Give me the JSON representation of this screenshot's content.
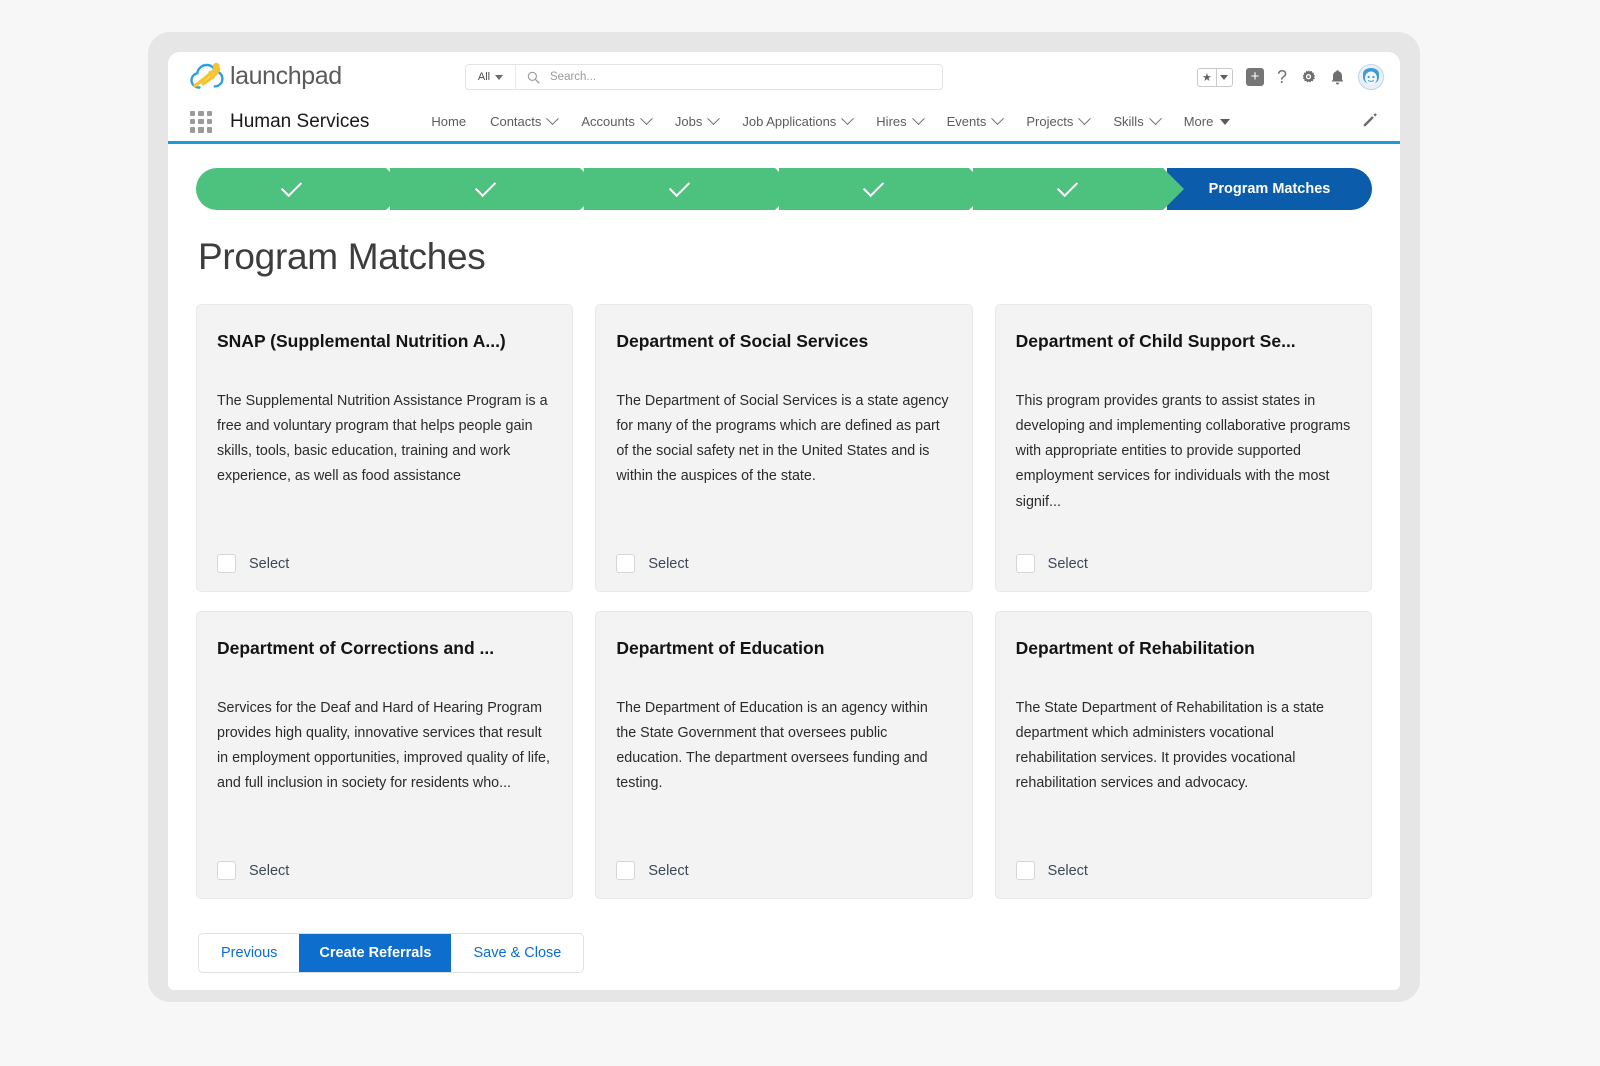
{
  "brand": {
    "logo_text": "launchpad",
    "logo_icon": "cloud-launch-icon"
  },
  "search": {
    "scope_label": "All",
    "placeholder": "Search...",
    "icon": "search-icon"
  },
  "header_actions": {
    "favorites_icon": "star-icon",
    "favorites_caret_icon": "caret-down-icon",
    "add_icon": "plus-square-icon",
    "help_icon": "question-mark-icon",
    "setup_icon": "gear-icon",
    "notifications_icon": "bell-icon",
    "avatar_icon": "user-avatar"
  },
  "app_nav": {
    "waffle_icon": "app-launcher-icon",
    "app_name": "Human Services",
    "edit_icon": "pencil-icon",
    "items": [
      {
        "label": "Home",
        "has_menu": false
      },
      {
        "label": "Contacts",
        "has_menu": true
      },
      {
        "label": "Accounts",
        "has_menu": true
      },
      {
        "label": "Jobs",
        "has_menu": true
      },
      {
        "label": "Job Applications",
        "has_menu": true
      },
      {
        "label": "Hires",
        "has_menu": true
      },
      {
        "label": "Events",
        "has_menu": true
      },
      {
        "label": "Projects",
        "has_menu": true
      },
      {
        "label": "Skills",
        "has_menu": true
      },
      {
        "label": "More",
        "has_menu": true,
        "solid_caret": true
      }
    ]
  },
  "path": {
    "completed_count": 5,
    "completed_icon": "check-icon",
    "current_label": "Program Matches",
    "completed_color": "#4dc27e",
    "current_color": "#0b5cab"
  },
  "page": {
    "title": "Program Matches"
  },
  "cards": [
    {
      "title": "SNAP (Supplemental Nutrition A...)",
      "description": "The Supplemental Nutrition Assistance Program is a free and voluntary program that helps people gain skills, tools, basic education, training and work experience, as well as food assistance",
      "select_label": "Select",
      "checked": false
    },
    {
      "title": "Department of Social Services",
      "description": "The Department of Social Services is a state agency for many of the programs which are defined as part of the social safety net in the United States and is within the auspices of the state.",
      "select_label": "Select",
      "checked": false
    },
    {
      "title": "Department of Child Support Se...",
      "description": "This program provides grants to assist states in developing and implementing collaborative programs with appropriate entities to provide supported employment services for individuals with the most signif...",
      "select_label": "Select",
      "checked": false
    },
    {
      "title": "Department of Corrections and ...",
      "description": "Services for the Deaf and Hard of Hearing Program provides high quality, innovative services that result in employment opportunities, improved quality of life, and full inclusion in society for residents who...",
      "select_label": "Select",
      "checked": false
    },
    {
      "title": "Department of Education",
      "description": "The Department of Education is an agency within the State Government that oversees public education. The department oversees funding and testing.",
      "select_label": "Select",
      "checked": false
    },
    {
      "title": "Department of Rehabilitation",
      "description": "The State Department of Rehabilitation is a state department which administers vocational rehabilitation services. It provides vocational rehabilitation services and advocacy.",
      "select_label": "Select",
      "checked": false
    }
  ],
  "footer": {
    "previous_label": "Previous",
    "create_referrals_label": "Create Referrals",
    "save_close_label": "Save & Close",
    "primary_color": "#0d6ecd",
    "link_color": "#0a6ed1"
  }
}
